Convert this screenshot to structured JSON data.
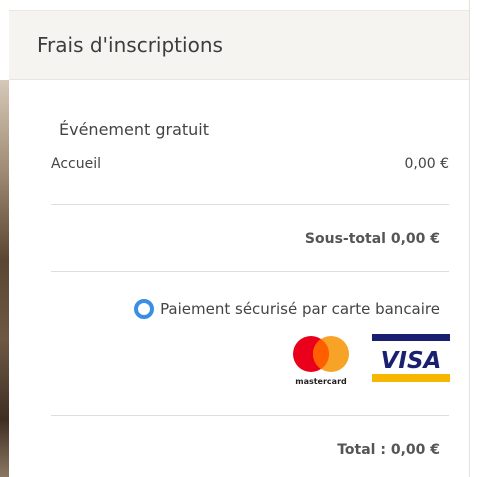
{
  "header": {
    "title": "Frais d'inscriptions"
  },
  "section": {
    "title": "Événement gratuit"
  },
  "items": [
    {
      "label": "Accueil",
      "price": "0,00 €"
    }
  ],
  "subtotal": "Sous-total 0,00 €",
  "payment": {
    "label": "Paiement sécurisé par carte bancaire",
    "selected": true,
    "accent": "#3a8ee6",
    "cards": [
      {
        "icon": "mastercard-logo",
        "text": "mastercard"
      },
      {
        "icon": "visa-logo",
        "text": "VISA"
      }
    ]
  },
  "total": "Total : 0,00 €"
}
